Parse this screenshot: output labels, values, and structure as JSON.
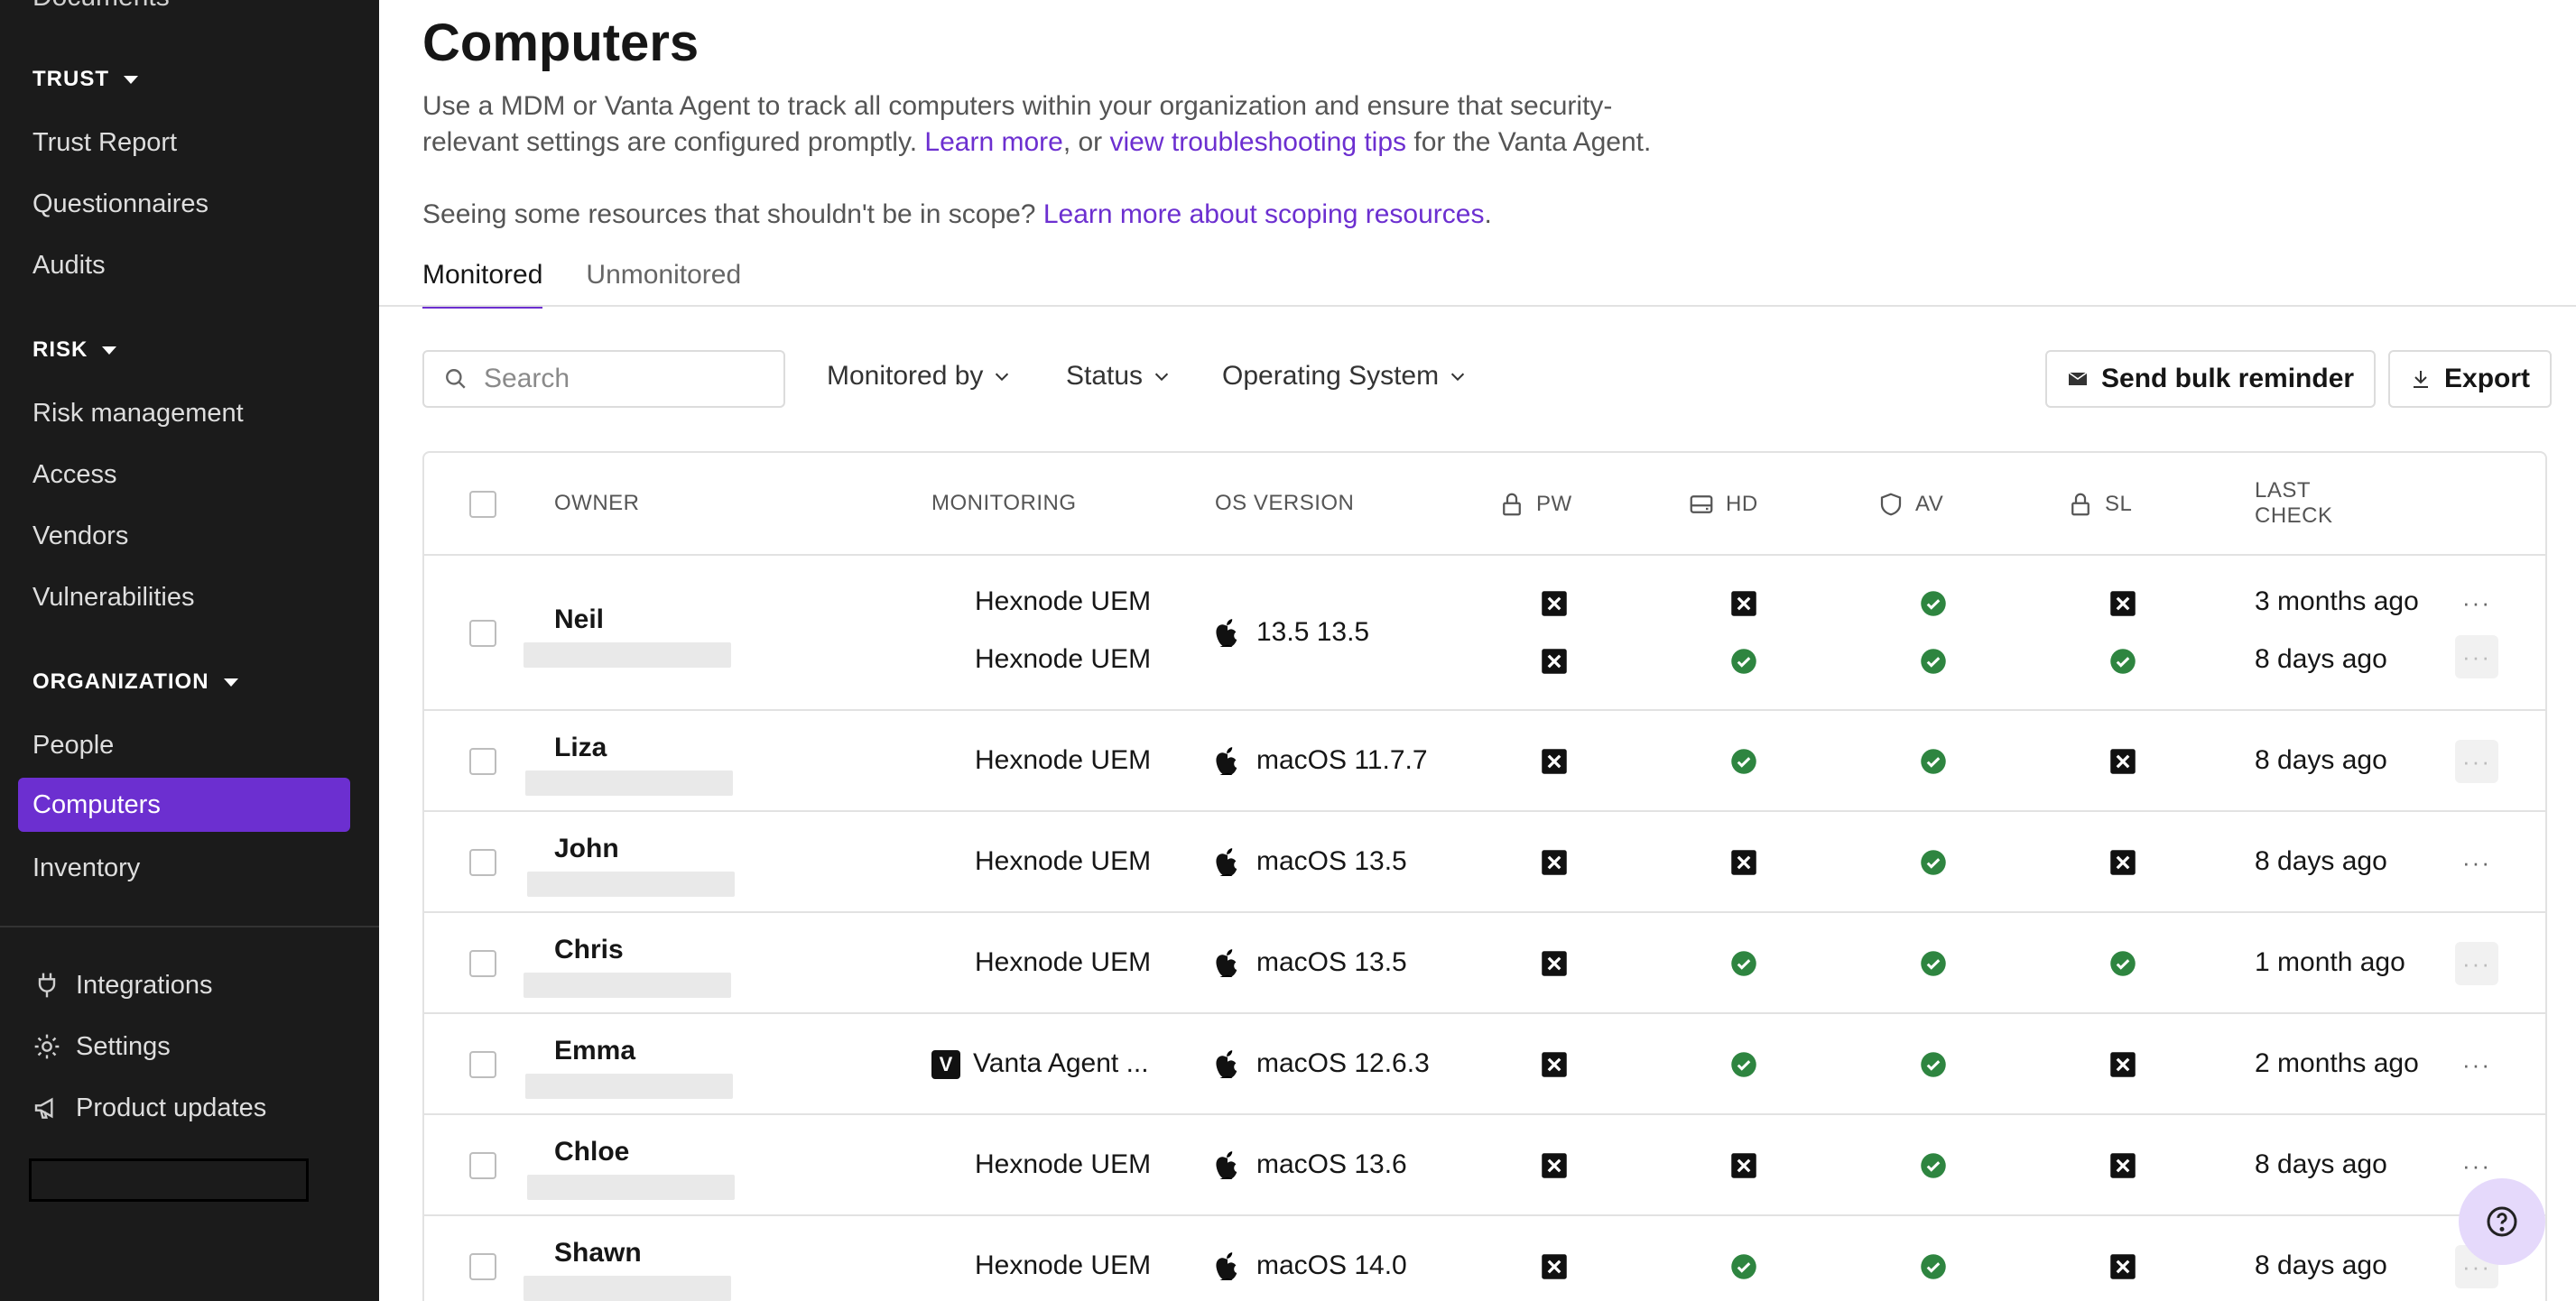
{
  "sidebar": {
    "top_clipped": "Documents",
    "sections": [
      {
        "label": "TRUST",
        "items": [
          "Trust Report",
          "Questionnaires",
          "Audits"
        ]
      },
      {
        "label": "RISK",
        "items": [
          "Risk management",
          "Access",
          "Vendors",
          "Vulnerabilities"
        ]
      },
      {
        "label": "ORGANIZATION",
        "items": [
          "People",
          "Computers",
          "Inventory"
        ]
      }
    ],
    "active_item": "Computers",
    "tools": [
      "Integrations",
      "Settings",
      "Product updates"
    ]
  },
  "page": {
    "title": "Computers",
    "desc_line1": "Use a MDM or Vanta Agent to track all computers within your organization and ensure that security-",
    "desc_line2_a": "relevant settings are configured promptly. ",
    "desc_link1": "Learn more",
    "desc_line2_b": ", or ",
    "desc_link2": "view troubleshooting tips",
    "desc_line2_c": " for the Vanta Agent.",
    "scope_text": "Seeing some resources that shouldn't be in scope? ",
    "scope_link": "Learn more about scoping resources",
    "scope_end": "."
  },
  "tabs": [
    "Monitored",
    "Unmonitored"
  ],
  "active_tab": "Monitored",
  "filters": {
    "search_placeholder": "Search",
    "monitored_by": "Monitored by",
    "status": "Status",
    "os": "Operating System",
    "bulk_reminder": "Send bulk reminder",
    "export": "Export"
  },
  "table": {
    "headers": {
      "owner": "OWNER",
      "monitoring": "MONITORING",
      "os": "OS VERSION",
      "pw": "PW",
      "hd": "HD",
      "av": "AV",
      "sl": "SL",
      "last1": "LAST",
      "last2": "CHECK"
    },
    "rows": [
      {
        "owner": "Neil",
        "monitoring": "Hexnode UEM",
        "monitoring2": "Hexnode UEM",
        "os": "13.5 13.5",
        "pw": "fail",
        "hd": "fail",
        "av": "pass",
        "sl": "fail",
        "pw2": "fail",
        "hd2": "pass",
        "av2": "pass",
        "sl2": "pass",
        "last": "3 months ago",
        "last2": "8 days ago"
      },
      {
        "owner": "Liza",
        "monitoring": "Hexnode UEM",
        "os": "macOS 11.7.7",
        "pw": "fail",
        "hd": "pass",
        "av": "pass",
        "sl": "fail",
        "last": "8 days ago"
      },
      {
        "owner": "John",
        "monitoring": "Hexnode UEM",
        "os": "macOS 13.5",
        "pw": "fail",
        "hd": "fail",
        "av": "pass",
        "sl": "fail",
        "last": "8 days ago"
      },
      {
        "owner": "Chris",
        "monitoring": "Hexnode UEM",
        "os": "macOS 13.5",
        "pw": "fail",
        "hd": "pass",
        "av": "pass",
        "sl": "pass",
        "last": "1 month ago"
      },
      {
        "owner": "Emma",
        "monitoring": "Vanta Agent ...",
        "badge": "V",
        "os": "macOS 12.6.3",
        "pw": "fail",
        "hd": "pass",
        "av": "pass",
        "sl": "fail",
        "last": "2 months ago"
      },
      {
        "owner": "Chloe",
        "monitoring": "Hexnode UEM",
        "os": "macOS 13.6",
        "pw": "fail",
        "hd": "fail",
        "av": "pass",
        "sl": "fail",
        "last": "8 days ago"
      },
      {
        "owner": "Shawn",
        "monitoring": "Hexnode UEM",
        "os": "macOS 14.0",
        "pw": "fail",
        "hd": "pass",
        "av": "pass",
        "sl": "fail",
        "last": "8 days ago"
      }
    ]
  },
  "colors": {
    "accent": "#6c2fd0",
    "pass": "#2e8540",
    "fail": "#111111"
  },
  "icons": {
    "pass": "check-circle-icon",
    "fail": "x-box-icon",
    "os": "apple-icon",
    "help": "help-icon"
  }
}
